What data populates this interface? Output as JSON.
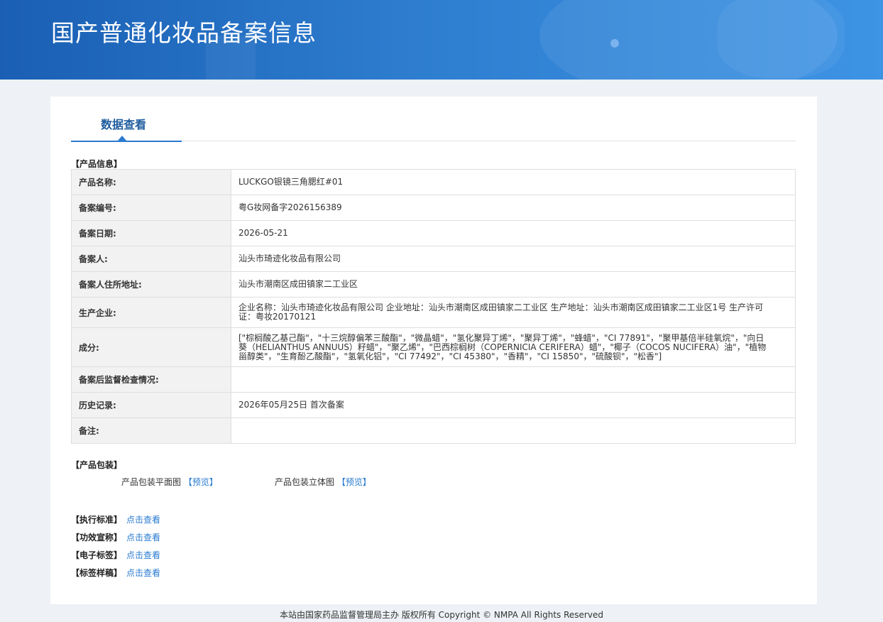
{
  "header": {
    "title": "国产普通化妆品备案信息"
  },
  "tab": {
    "label": "数据查看"
  },
  "product_info": {
    "section_label": "【产品信息】",
    "rows": [
      {
        "key": "产品名称:",
        "value": "LUCKGO银镜三角腮红#01"
      },
      {
        "key": "备案编号:",
        "value": "粤G妆网备字2026156389"
      },
      {
        "key": "备案日期:",
        "value": "2026-05-21"
      },
      {
        "key": "备案人:",
        "value": "汕头市琦迹化妆品有限公司"
      },
      {
        "key": "备案人住所地址:",
        "value": "汕头市潮南区成田镇家二工业区"
      },
      {
        "key": "生产企业:",
        "value": "企业名称：汕头市琦迹化妆品有限公司 企业地址：汕头市潮南区成田镇家二工业区 生产地址：汕头市潮南区成田镇家二工业区1号 生产许可证：粤妆20170121"
      },
      {
        "key": "成分:",
        "value": "[\"棕榈酸乙基己酯\"，\"十三烷醇偏苯三酸酯\"，\"微晶蜡\"，\"氢化聚异丁烯\"，\"聚异丁烯\"，\"蜂蜡\"，\"CI 77891\"，\"聚甲基倍半硅氧烷\"，\"向日葵（HELIANTHUS ANNUUS）籽蜡\"，\"聚乙烯\"，\"巴西棕榈树（COPERNICIA CERIFERA）蜡\"，\"椰子（COCOS NUCIFERA）油\"，\"植物甾醇类\"，\"生育酚乙酸酯\"，\"氢氧化铝\"，\"CI 77492\"，\"CI 45380\"，\"香精\"，\"CI 15850\"，\"硫酸钡\"，\"松香\"]"
      },
      {
        "key": "备案后监督检查情况:",
        "value": ""
      },
      {
        "key": "历史记录:",
        "value": "2026年05月25日 首次备案"
      },
      {
        "key": "备注:",
        "value": ""
      }
    ]
  },
  "packaging": {
    "section_label": "【产品包装】",
    "flat_label": "产品包装平面图",
    "flat_link": "【预览】",
    "stereo_label": "产品包装立体图",
    "stereo_link": "【预览】"
  },
  "extras": [
    {
      "label": "【执行标准】",
      "link": "点击查看"
    },
    {
      "label": "【功效宣称】",
      "link": "点击查看"
    },
    {
      "label": "【电子标签】",
      "link": "点击查看"
    },
    {
      "label": "【标签样稿】",
      "link": "点击查看"
    }
  ],
  "footer": {
    "text": "本站由国家药品监督管理局主办 版权所有 Copyright © NMPA All Rights Reserved"
  }
}
